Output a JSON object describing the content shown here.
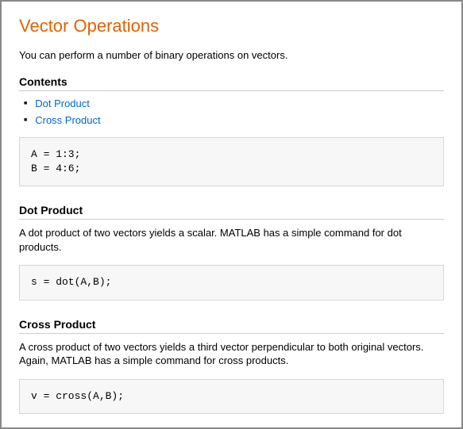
{
  "title": "Vector Operations",
  "intro": "You can perform a number of binary operations on vectors.",
  "contents_heading": "Contents",
  "toc": {
    "item1": "Dot Product",
    "item2": "Cross Product"
  },
  "code1": "A = 1:3;\nB = 4:6;",
  "section1": {
    "heading": "Dot Product",
    "desc": "A dot product of two vectors yields a scalar. MATLAB has a simple command for dot products.",
    "code": "s = dot(A,B);"
  },
  "section2": {
    "heading": "Cross Product",
    "desc": "A cross product of two vectors yields a third vector perpendicular to both original vectors. Again, MATLAB has a simple command for cross products.",
    "code": "v = cross(A,B);"
  }
}
